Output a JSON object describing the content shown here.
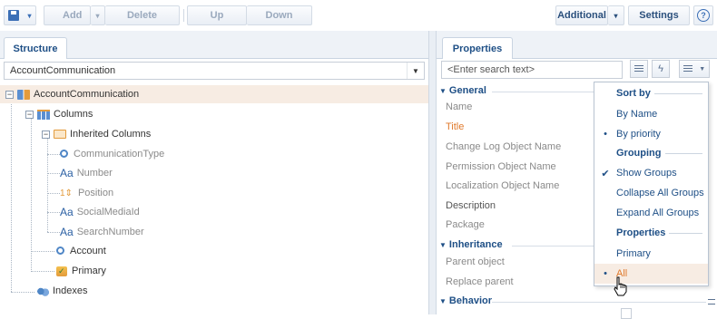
{
  "toolbar": {
    "save_arrow": "▾",
    "add_label": "Add",
    "add_arrow": "▾",
    "delete_label": "Delete",
    "up_label": "Up",
    "down_label": "Down",
    "additional_label": "Additional",
    "additional_arrow": "▾",
    "settings_label": "Settings",
    "help_glyph": "?"
  },
  "structure": {
    "tab_label": "Structure",
    "selected_object": "AccountCommunication",
    "tree": [
      {
        "label": "AccountCommunication",
        "icon": "schema-icon",
        "expander": "−"
      },
      {
        "label": "Columns",
        "icon": "columns-icon",
        "expander": "−"
      },
      {
        "label": "Inherited Columns",
        "icon": "folder-icon",
        "expander": "−"
      },
      {
        "label": "CommunicationType",
        "icon": "lookup-icon"
      },
      {
        "label": "Number",
        "icon": "text-icon",
        "glyph": "Aa"
      },
      {
        "label": "Position",
        "icon": "integer-icon",
        "glyph": "1⇕"
      },
      {
        "label": "SocialMediaId",
        "icon": "text-icon",
        "glyph": "Aa"
      },
      {
        "label": "SearchNumber",
        "icon": "text-icon",
        "glyph": "Aa"
      },
      {
        "label": "Account",
        "icon": "lookup-icon"
      },
      {
        "label": "Primary",
        "icon": "boolean-icon"
      },
      {
        "label": "Indexes",
        "icon": "indexes-icon"
      }
    ]
  },
  "properties": {
    "tab_label": "Properties",
    "search_placeholder": "<Enter search text>",
    "groups": {
      "general": "General",
      "inheritance": "Inheritance",
      "behavior": "Behavior"
    },
    "general_rows": [
      "Name",
      "Title",
      "Change Log Object Name",
      "Permission Object Name",
      "Localization Object Name",
      "Description",
      "Package"
    ],
    "inheritance_rows": [
      "Parent object",
      "Replace parent"
    ]
  },
  "menu": {
    "sort_by_header": "Sort by",
    "by_name": "By Name",
    "by_priority": "By priority",
    "grouping_header": "Grouping",
    "show_groups": "Show Groups",
    "collapse_all": "Collapse All Groups",
    "expand_all": "Expand All Groups",
    "properties_header": "Properties",
    "primary": "Primary",
    "all": "All",
    "bullet": "•",
    "check": "✔"
  },
  "colors": {
    "accent": "#1e4f86",
    "selection": "#f7ece3",
    "title_orange": "#e07a2c"
  }
}
